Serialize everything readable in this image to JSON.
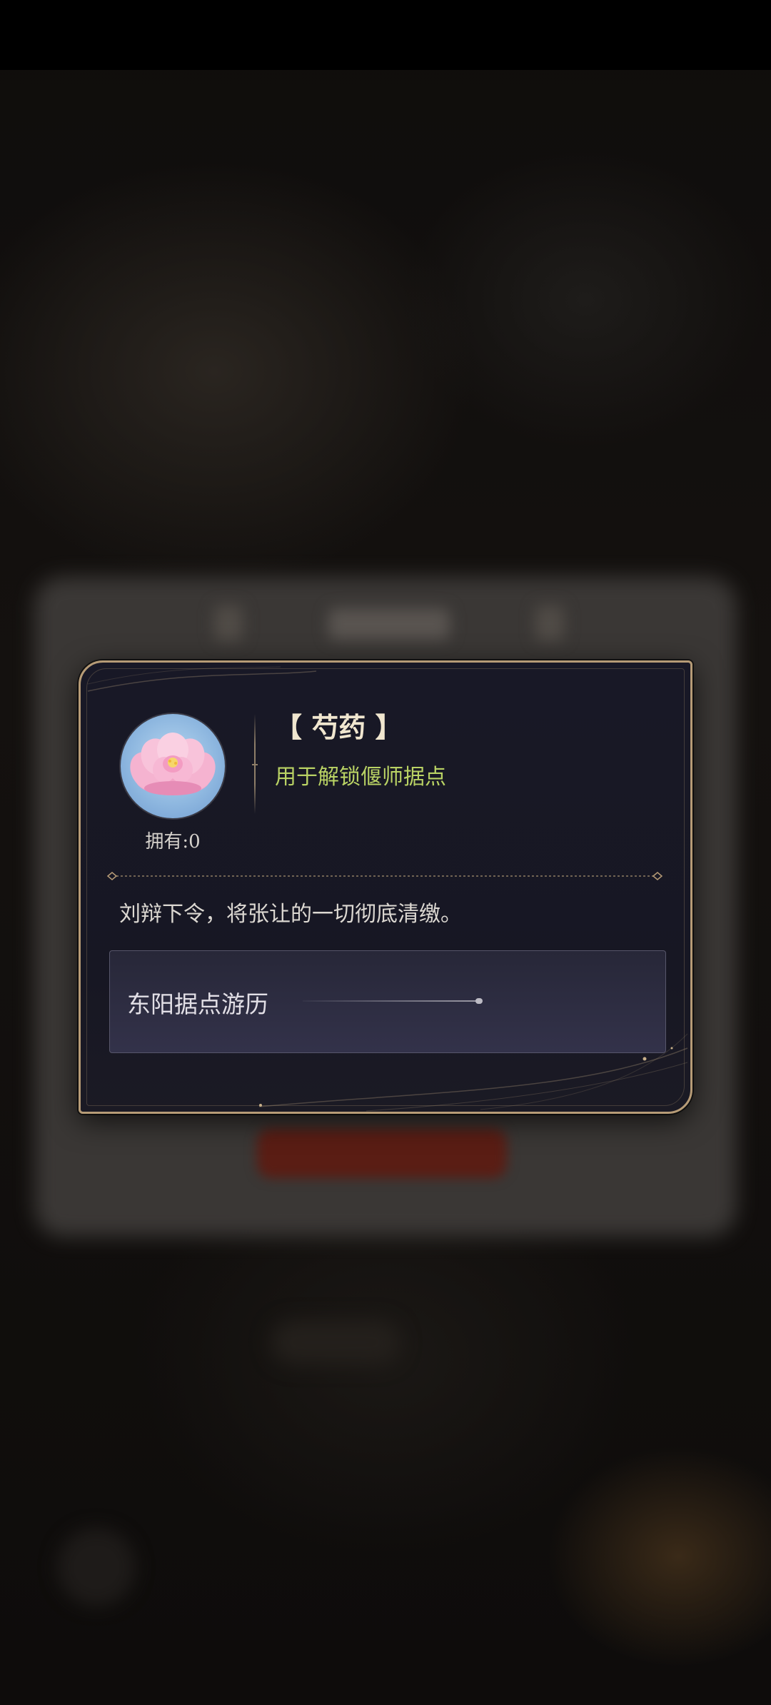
{
  "item": {
    "name": "【 芍药 】",
    "usage": "用于解锁偃师据点",
    "owned": "拥有:0",
    "description": "刘辩下令，将张让的一切彻底清缴。",
    "icon": "peony-flower-icon"
  },
  "source": {
    "label": "东阳据点游历"
  },
  "colors": {
    "card_border": "#b69b76",
    "card_bg": "#181826",
    "usage_text": "#b9d264",
    "title_text": "#f0e6cf"
  }
}
